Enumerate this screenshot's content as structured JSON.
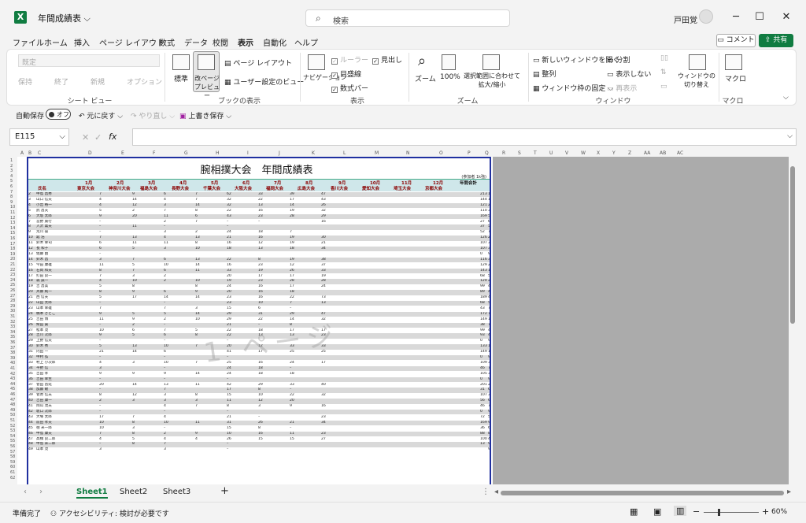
{
  "app": {
    "doc_title": "年間成績表",
    "search_placeholder": "検索",
    "user_name": "戸田覚",
    "logo_letter": "X"
  },
  "tabs": [
    "ファイル",
    "ホーム",
    "挿入",
    "ページ レイアウト",
    "数式",
    "データ",
    "校閲",
    "表示",
    "自動化",
    "ヘルプ"
  ],
  "active_tab": "表示",
  "header_buttons": {
    "comment": "コメント",
    "share": "共有"
  },
  "ribbon": {
    "sheetview_dropdown": "既定",
    "sheetview_items": [
      "保持",
      "終了",
      "新規",
      "オプション"
    ],
    "sheetview_group": "シート ビュー",
    "workbook_views": {
      "normal": "標準",
      "page_break": "改ページ プレビュー",
      "page_layout": "ページ レイアウト",
      "custom": "ユーザー設定のビュー",
      "group": "ブックの表示"
    },
    "show": {
      "navigation": "ナビゲーション",
      "ruler": "ルーラー",
      "gridlines": "目盛線",
      "formula_bar": "数式バー",
      "headings": "見出し",
      "group": "表示"
    },
    "zoom": {
      "zoom": "ズーム",
      "hundred": "100%",
      "fit": "選択範囲に合わせて拡大/縮小",
      "group": "ズーム"
    },
    "window": {
      "new_window": "新しいウィンドウを開く",
      "arrange": "整列",
      "freeze": "ウィンドウ枠の固定",
      "split": "分割",
      "hide": "表示しない",
      "unhide": "再表示",
      "switch": "ウィンドウの切り替え",
      "group": "ウィンドウ"
    },
    "macro": {
      "label": "マクロ",
      "group": "マクロ"
    }
  },
  "quick_access": {
    "autosave": "自動保存",
    "autosave_state": "オフ",
    "undo": "元に戻す",
    "redo": "やり直し",
    "save": "上書き保存"
  },
  "formula_bar": {
    "name_box": "E115",
    "fx": "fx",
    "value": ""
  },
  "columns": [
    "A",
    "B",
    "C",
    "D",
    "E",
    "F",
    "G",
    "H",
    "I",
    "J",
    "K",
    "L",
    "M",
    "N",
    "O",
    "P",
    "Q",
    "R",
    "S",
    "T",
    "U",
    "V",
    "W",
    "X",
    "Y",
    "Z",
    "AA",
    "AB",
    "AC"
  ],
  "report": {
    "title": "腕相撲大会　年間成績表",
    "note": "(参加者 1k強)",
    "header_name": "氏名",
    "header_total": "年間合計",
    "months": [
      {
        "m": "1月",
        "e": "東京大会"
      },
      {
        "m": "2月",
        "e": "神奈川大会"
      },
      {
        "m": "3月",
        "e": "福島大会"
      },
      {
        "m": "4月",
        "e": "長野大会"
      },
      {
        "m": "5月",
        "e": "千葉大会"
      },
      {
        "m": "6月",
        "e": "大阪大会"
      },
      {
        "m": "7月",
        "e": "福岡大会"
      },
      {
        "m": "8月",
        "e": "広島大会"
      },
      {
        "m": "9月",
        "e": "香川大会"
      },
      {
        "m": "10月",
        "e": "愛知大会"
      },
      {
        "m": "11月",
        "e": "埼玉大会"
      },
      {
        "m": "12月",
        "e": "京都大会"
      }
    ],
    "watermark": "1 ページ",
    "rows": [
      [
        "2",
        "中島 昌秀",
        "7",
        "9",
        "6",
        "7",
        "62",
        "33",
        "39",
        "47",
        "213",
        "1"
      ],
      [
        "3",
        "山口 信夫",
        "4",
        "14",
        "4",
        "7",
        "32",
        "22",
        "17",
        "43",
        "144",
        "17"
      ],
      [
        "4",
        "小出 裕一",
        "4",
        "12",
        "3",
        "14",
        "32",
        "13",
        "14",
        "26",
        "121",
        "27"
      ],
      [
        "5",
        "武 昌夫",
        "5",
        "2",
        "7",
        "8",
        "22",
        "16",
        "19",
        "32",
        "110",
        "32"
      ],
      [
        "6",
        "大坂 太郎",
        "9",
        "20",
        "11",
        "6",
        "43",
        "23",
        "28",
        "29",
        "169",
        "5"
      ],
      [
        "7",
        "宮野 辰行",
        "–",
        "",
        "2",
        "7",
        "–",
        "–",
        "",
        "16",
        "27",
        "67"
      ],
      [
        "8",
        "入沢 薫夫",
        "–",
        "11",
        "–",
        "",
        "–",
        "",
        "",
        "",
        "37",
        "57"
      ],
      [
        "9",
        "荒川 操",
        "–",
        "",
        "3",
        "2",
        "24",
        "18",
        "7",
        "",
        "52",
        "71"
      ],
      [
        "10",
        "舘 浩",
        "7",
        "13",
        "4",
        "13",
        "21",
        "16",
        "19",
        "30",
        "126",
        "24"
      ],
      [
        "11",
        "鈴木 幸司",
        "6",
        "11",
        "11",
        "8",
        "16",
        "12",
        "19",
        "21",
        "107",
        "35"
      ],
      [
        "12",
        "長 和子",
        "6",
        "5",
        "3",
        "10",
        "18",
        "13",
        "18",
        "34",
        "107",
        "33"
      ],
      [
        "13",
        "佐藤 由",
        "–",
        "",
        "",
        "",
        "",
        "",
        "",
        "",
        "0",
        "93"
      ],
      [
        "14",
        "鈴木 昌",
        "3",
        "7",
        "6",
        "13",
        "22",
        "8",
        "19",
        "38",
        "116",
        "30"
      ],
      [
        "15",
        "今田 康雄",
        "11",
        "5",
        "10",
        "14",
        "16",
        "23",
        "12",
        "37",
        "129",
        "23"
      ],
      [
        "16",
        "石岡 和夫",
        "8",
        "7",
        "6",
        "11",
        "33",
        "19",
        "26",
        "33",
        "143",
        "18"
      ],
      [
        "17",
        "打田 良一",
        "7",
        "3",
        "2",
        "",
        "20",
        "17",
        "17",
        "19",
        "68",
        "52"
      ],
      [
        "18",
        "森 誠一",
        "4",
        "10",
        "2",
        "10",
        "19",
        "23",
        "28",
        "28",
        "124",
        "26"
      ],
      [
        "19",
        "吉 昌美",
        "5",
        "8",
        "",
        "8",
        "24",
        "16",
        "17",
        "24",
        "99",
        "45"
      ],
      [
        "20",
        "斉藤 純一",
        "8",
        "9",
        "6",
        "9",
        "20",
        "16",
        "18",
        "",
        "89",
        "48"
      ],
      [
        "21",
        "西 信夫",
        "5",
        "17",
        "14",
        "14",
        "23",
        "16",
        "22",
        "73",
        "189",
        "4"
      ],
      [
        "22",
        "山田 太郎",
        "–",
        "",
        "–",
        "",
        "23",
        "10",
        "7",
        "13",
        "68",
        "55"
      ],
      [
        "23",
        "山本 幸雄",
        "7",
        "",
        "7",
        "3",
        "15",
        "6",
        "–",
        "",
        "43",
        "73"
      ],
      [
        "24",
        "橋本 さとこ",
        "9",
        "5",
        "5",
        "14",
        "29",
        "31",
        "29",
        "47",
        "172",
        "7"
      ],
      [
        "25",
        "吉田 博",
        "11",
        "9",
        "2",
        "10",
        "29",
        "22",
        "14",
        "32",
        "149",
        "12"
      ],
      [
        "26",
        "柴田 貴",
        "–",
        "2",
        "–",
        "",
        "21",
        "–",
        "8",
        "",
        "38",
        "76"
      ],
      [
        "27",
        "松本 茂",
        "10",
        "6",
        "7",
        "5",
        "22",
        "18",
        "17",
        "17",
        "99",
        "44"
      ],
      [
        "28",
        "吉川 次郎",
        "9",
        "5",
        "6",
        "8",
        "22",
        "13",
        "13",
        "23",
        "93",
        "47"
      ],
      [
        "29",
        "上野 信夫",
        "–",
        "",
        "–",
        "",
        "–",
        "",
        "",
        "",
        "0",
        "93"
      ],
      [
        "30",
        "鈴木 秀",
        "5",
        "13",
        "10",
        "7",
        "20",
        "12",
        "33",
        "33",
        "133",
        "19"
      ],
      [
        "31",
        "内田 一",
        "21",
        "14",
        "6",
        "",
        "41",
        "17",
        "25",
        "25",
        "149",
        "13"
      ],
      [
        "32",
        "中村 弘",
        "–",
        "",
        "–",
        "",
        "–",
        "",
        "",
        "",
        "0",
        "93"
      ],
      [
        "33",
        "村上 小次郎",
        "4",
        "3",
        "10",
        "7",
        "25",
        "16",
        "24",
        "17",
        "109",
        "35"
      ],
      [
        "34",
        "平野 信",
        "3",
        "",
        "–",
        "",
        "24",
        "18",
        "–",
        "",
        "46",
        "75"
      ],
      [
        "35",
        "吉田 孝",
        "9",
        "9",
        "9",
        "14",
        "24",
        "18",
        "18",
        "",
        "105",
        "37"
      ],
      [
        "36",
        "吉田 幸生",
        "–",
        "",
        "–",
        "",
        "–",
        "",
        "",
        "",
        "0",
        "93"
      ],
      [
        "37",
        "菅田 昌延",
        "20",
        "14",
        "13",
        "11",
        "42",
        "29",
        "33",
        "40",
        "201",
        "2"
      ],
      [
        "38",
        "加藤 敏",
        "–",
        "",
        "7",
        "",
        "17",
        "8",
        "–",
        "",
        "31",
        "64"
      ],
      [
        "39",
        "菅原 信夫",
        "8",
        "12",
        "3",
        "8",
        "15",
        "10",
        "22",
        "32",
        "107",
        "34"
      ],
      [
        "40",
        "吉田 康一",
        "2",
        "3",
        "3",
        "3",
        "11",
        "12",
        "20",
        "",
        "56",
        "68"
      ],
      [
        "41",
        "岡山 茂夫",
        "–",
        "",
        "4",
        "7",
        "8",
        "3",
        "9",
        "16",
        "46",
        "72"
      ],
      [
        "42",
        "坂口 次郎",
        "–",
        "",
        "–",
        "",
        "–",
        "",
        "",
        "",
        "0",
        "93"
      ],
      [
        "43",
        "大塚 太郎",
        "17",
        "7",
        "4",
        "",
        "21",
        "–",
        "",
        "23",
        "72",
        "51"
      ],
      [
        "44",
        "前田 孝夫",
        "10",
        "8",
        "10",
        "11",
        "31",
        "26",
        "21",
        "34",
        "169",
        "9"
      ],
      [
        "45",
        "徳 米一郎",
        "10",
        "3",
        "–",
        "",
        "15",
        "8",
        "–",
        "",
        "36",
        "68"
      ],
      [
        "46",
        "中島 康夫",
        "7",
        "8",
        "2",
        "9",
        "10",
        "16",
        "11",
        "23",
        "88",
        "84"
      ],
      [
        "47",
        "高橋 良二郎",
        "4",
        "5",
        "4",
        "4",
        "26",
        "15",
        "15",
        "27",
        "100",
        "41"
      ],
      [
        "48",
        "中島 米二郎",
        "–",
        "8",
        "7",
        "",
        "–",
        "",
        "",
        "",
        "13",
        "90"
      ],
      [
        "49",
        "山本 茂",
        "3",
        "",
        "3",
        "",
        "–",
        "",
        "",
        "",
        "",
        "93"
      ]
    ]
  },
  "sheets": [
    "Sheet1",
    "Sheet2",
    "Sheet3"
  ],
  "active_sheet": "Sheet1",
  "status": {
    "ready": "準備完了",
    "accessibility": "アクセシビリティ: 検討が必要です",
    "zoom": "60%"
  }
}
